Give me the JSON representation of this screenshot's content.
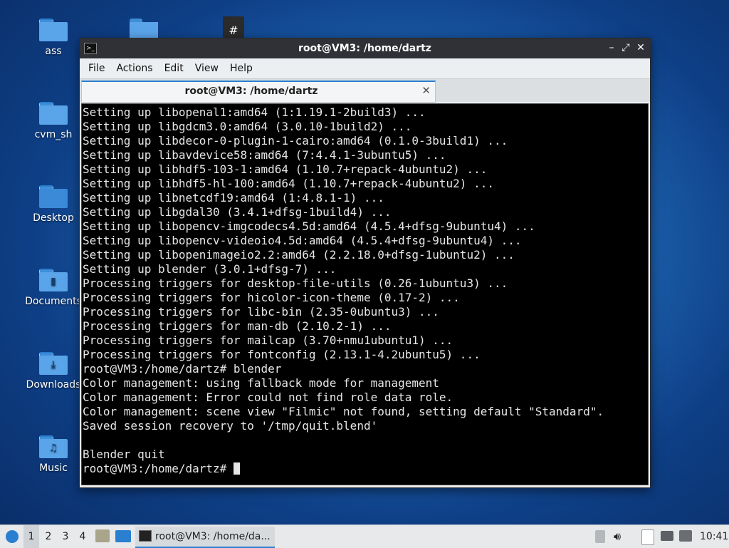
{
  "desktop": {
    "icons": [
      {
        "label": "ass",
        "glyph": ""
      },
      {
        "label": "cvm_sh",
        "glyph": ""
      },
      {
        "label": "Desktop",
        "glyph": ""
      },
      {
        "label": "Documents",
        "glyph": "▮"
      },
      {
        "label": "Downloads",
        "glyph": "⤓"
      },
      {
        "label": "Music",
        "glyph": "♫"
      }
    ]
  },
  "window": {
    "title": "root@VM3: /home/dartz",
    "menu": [
      "File",
      "Actions",
      "Edit",
      "View",
      "Help"
    ],
    "tab_title": "root@VM3: /home/dartz",
    "controls": {
      "minimize": "–",
      "maximize": "⤢",
      "close": "✕"
    },
    "tab_close": "✕"
  },
  "terminal": {
    "lines": [
      "Setting up libopenal1:amd64 (1:1.19.1-2build3) ...",
      "Setting up libgdcm3.0:amd64 (3.0.10-1build2) ...",
      "Setting up libdecor-0-plugin-1-cairo:amd64 (0.1.0-3build1) ...",
      "Setting up libavdevice58:amd64 (7:4.4.1-3ubuntu5) ...",
      "Setting up libhdf5-103-1:amd64 (1.10.7+repack-4ubuntu2) ...",
      "Setting up libhdf5-hl-100:amd64 (1.10.7+repack-4ubuntu2) ...",
      "Setting up libnetcdf19:amd64 (1:4.8.1-1) ...",
      "Setting up libgdal30 (3.4.1+dfsg-1build4) ...",
      "Setting up libopencv-imgcodecs4.5d:amd64 (4.5.4+dfsg-9ubuntu4) ...",
      "Setting up libopencv-videoio4.5d:amd64 (4.5.4+dfsg-9ubuntu4) ...",
      "Setting up libopenimageio2.2:amd64 (2.2.18.0+dfsg-1ubuntu2) ...",
      "Setting up blender (3.0.1+dfsg-7) ...",
      "Processing triggers for desktop-file-utils (0.26-1ubuntu3) ...",
      "Processing triggers for hicolor-icon-theme (0.17-2) ...",
      "Processing triggers for libc-bin (2.35-0ubuntu3) ...",
      "Processing triggers for man-db (2.10.2-1) ...",
      "Processing triggers for mailcap (3.70+nmu1ubuntu1) ...",
      "Processing triggers for fontconfig (2.13.1-4.2ubuntu5) ...",
      "root@VM3:/home/dartz# blender",
      "Color management: using fallback mode for management",
      "Color management: Error could not find role data role.",
      "Color management: scene view \"Filmic\" not found, setting default \"Standard\".",
      "Saved session recovery to '/tmp/quit.blend'",
      "",
      "Blender quit"
    ],
    "prompt": "root@VM3:/home/dartz# "
  },
  "taskbar": {
    "workspaces": [
      "1",
      "2",
      "3",
      "4"
    ],
    "active_workspace": "1",
    "task_label": "root@VM3: /home/da...",
    "clock": "10:41"
  }
}
